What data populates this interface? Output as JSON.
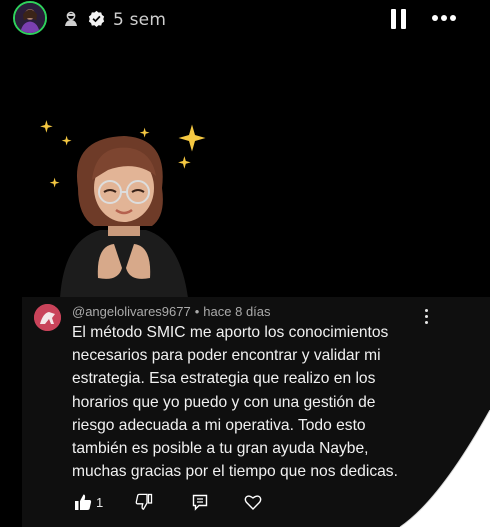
{
  "header": {
    "time_ago": "5 sem",
    "colors": {
      "avatar_ring": "#2fd15c",
      "text": "#cfcfcf"
    },
    "icons": [
      "collab-icon",
      "verified-icon",
      "pause-icon",
      "more-icon"
    ]
  },
  "comment": {
    "author": "@angelolivares9677",
    "separator": "•",
    "time": "hace 8 días",
    "lines": [
      "El método SMIC me aporto los conocimientos",
      "necesarios para poder encontrar y validar mi",
      "estrategia. Esa estrategia que realizo en los",
      "horarios que yo puedo y con una gestión de",
      "riesgo adecuada a mi operativa. Todo esto",
      "también es posible a tu gran ayuda Naybe,",
      "muchas gracias por el tiempo que nos dedicas."
    ],
    "likes": "1",
    "icons": [
      "thumb-up-icon",
      "thumb-down-icon",
      "reply-icon",
      "heart-icon"
    ]
  }
}
